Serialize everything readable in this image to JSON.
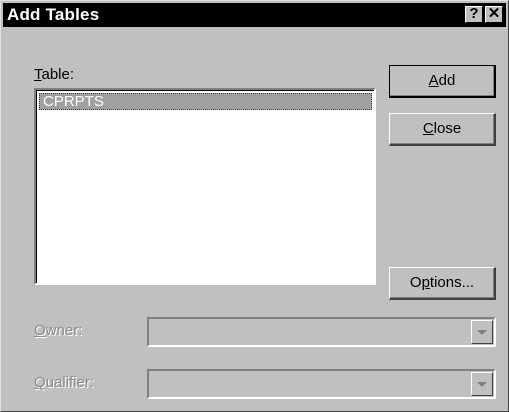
{
  "window": {
    "title": "Add Tables",
    "help_glyph": "?",
    "close_glyph": "✕"
  },
  "table_section": {
    "label_mnemonic": "T",
    "label_rest": "able:",
    "items": [
      "CPRPTS"
    ],
    "selected_index": 0
  },
  "buttons": {
    "add_mnemonic": "A",
    "add_rest": "dd",
    "close_mnemonic": "C",
    "close_rest": "lose",
    "options_pre": "O",
    "options_mnemonic": "p",
    "options_rest": "tions..."
  },
  "owner": {
    "label_mnemonic": "O",
    "label_rest": "wner:",
    "value": "",
    "enabled": false
  },
  "qualifier": {
    "label_mnemonic": "Q",
    "label_rest": "ualifier:",
    "value": "",
    "enabled": false
  },
  "colors": {
    "face": "#c0c0c0",
    "titlebar": "#000000",
    "selection": "#a0a0a0",
    "disabled_text": "#8a8a8a"
  }
}
